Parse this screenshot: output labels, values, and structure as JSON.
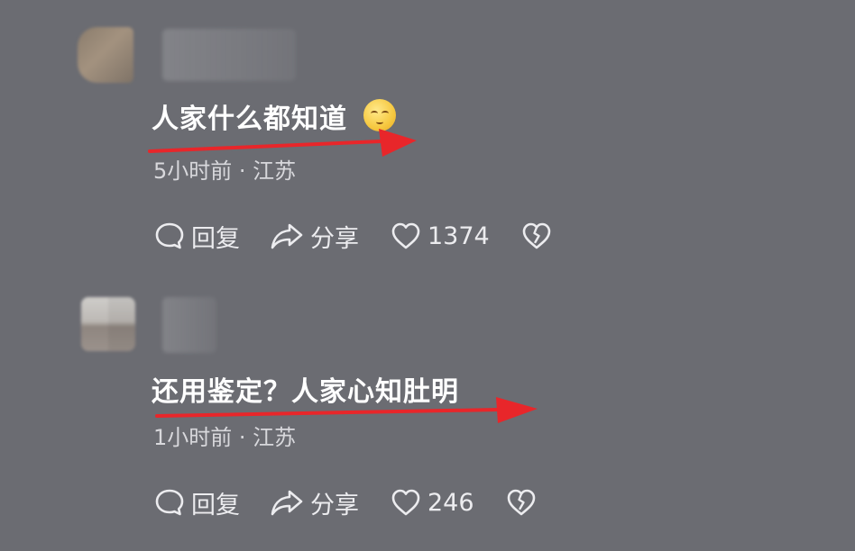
{
  "comments": [
    {
      "text": "人家什么都知道",
      "emoji": "smiling-face-emoji",
      "meta": "5小时前 · 江苏",
      "actions": {
        "reply": "回复",
        "share": "分享",
        "likes": "1374"
      }
    },
    {
      "text": "还用鉴定？人家心知肚明",
      "meta": "1小时前 · 江苏",
      "actions": {
        "reply": "回复",
        "share": "分享",
        "likes": "246"
      }
    }
  ],
  "icons": {
    "reply": "speech-bubble-icon",
    "share": "share-arrow-icon",
    "like": "heart-outline-icon",
    "dislike": "broken-heart-icon"
  },
  "colors": {
    "background": "#6b6c72",
    "text": "#ffffff",
    "meta_text": "#d8d8dc",
    "annotation_arrow": "#e8262a"
  }
}
